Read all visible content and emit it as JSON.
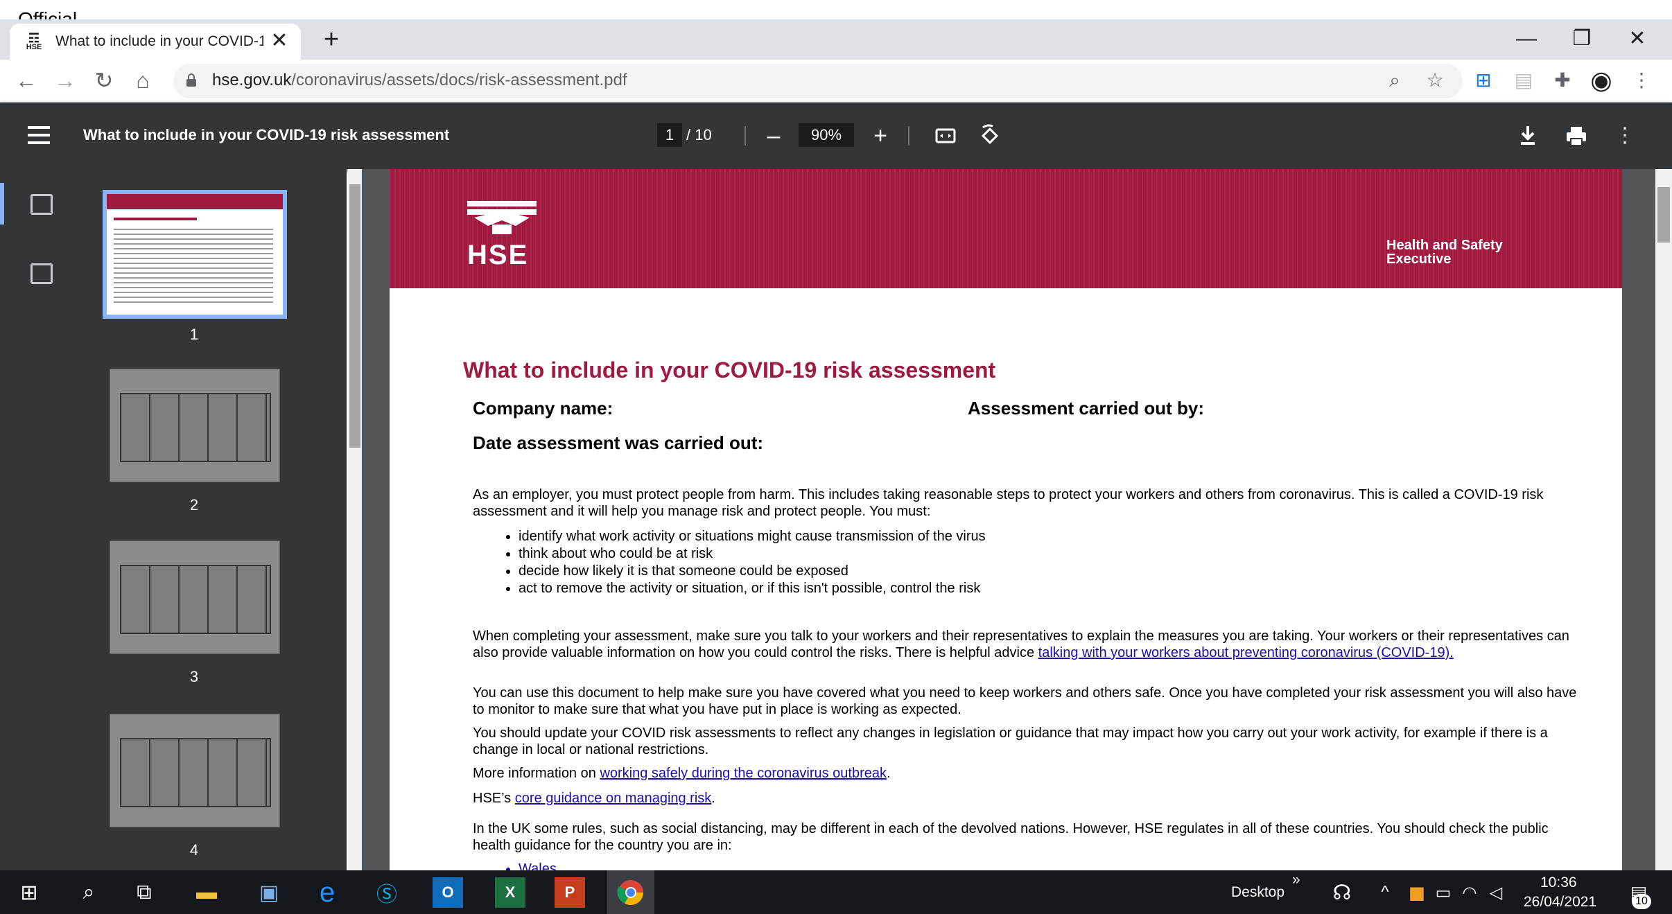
{
  "official_label": "Official",
  "browser": {
    "tab_title": "What to include in your COVID-1",
    "tab_close": "✕",
    "new_tab": "+",
    "url_domain": "hse.gov.uk",
    "url_path": "/coronavirus/assets/docs/risk-assessment.pdf",
    "window_minimize": "—",
    "window_restore": "❐",
    "window_close": "✕"
  },
  "pdf_toolbar": {
    "title": "What to include in your COVID-19 risk assessment",
    "current_page": "1",
    "total_pages": "/ 10",
    "zoom": "90%",
    "zoom_out": "–",
    "zoom_in": "+"
  },
  "sidebar": {
    "thumbnails": [
      "1",
      "2",
      "3",
      "4"
    ]
  },
  "document": {
    "org_name": "Health and Safety Executive",
    "logo_text": "HSE",
    "title": "What to include in your COVID-19 risk assessment",
    "company_label": "Company name:",
    "assessor_label": "Assessment carried out by:",
    "date_label": "Date assessment was carried out:",
    "intro": "As an employer, you must protect people from harm. This includes taking reasonable steps to protect your workers and others from coronavirus. This is called a COVID-19 risk assessment and it will help you manage risk and protect people. You must:",
    "bullets": [
      "identify what work activity or situations might cause transmission of the virus",
      "think about who could be at risk",
      "decide how likely it is that someone could be exposed",
      "act to remove the activity or situation, or if this isn't possible, control the risk"
    ],
    "completing_text": "When completing your assessment, make sure you talk to your workers and their representatives to explain the measures you are taking. Your workers or their representatives  can also provide valuable information on how you could control the risks. There is helpful advice",
    "completing_link": "talking with your workers about preventing coronavirus (COVID-19).",
    "use_doc": "You can use this document to help make sure you have covered what you need to keep workers and others safe. Once you have completed your risk assessment you will also have to monitor to make sure that what you have put in place is working as expected.",
    "update": "You should update your COVID risk assessments to reflect any changes in legislation or guidance that may impact how you carry out your work activity, for example if there is a change in local or national restrictions.",
    "more_info_prefix": "More information on",
    "more_info_link": "working safely during the coronavirus outbreak",
    "core_prefix": "HSE’s",
    "core_link": "core guidance on managing risk",
    "uk_rules": "In the UK some rules, such as social distancing, may be different in each of the devolved nations. However, HSE regulates in all of these countries. You should check the public health guidance for the country you are in:",
    "next_bullet": "Wales"
  },
  "taskbar": {
    "desktop_label": "Desktop",
    "chevrons": "»",
    "time": "10:36",
    "date": "26/04/2021",
    "notification_count": "10"
  },
  "colors": {
    "hse_red": "#a01a40",
    "pdf_toolbar": "#323639",
    "selection_blue": "#8ab4f8"
  }
}
